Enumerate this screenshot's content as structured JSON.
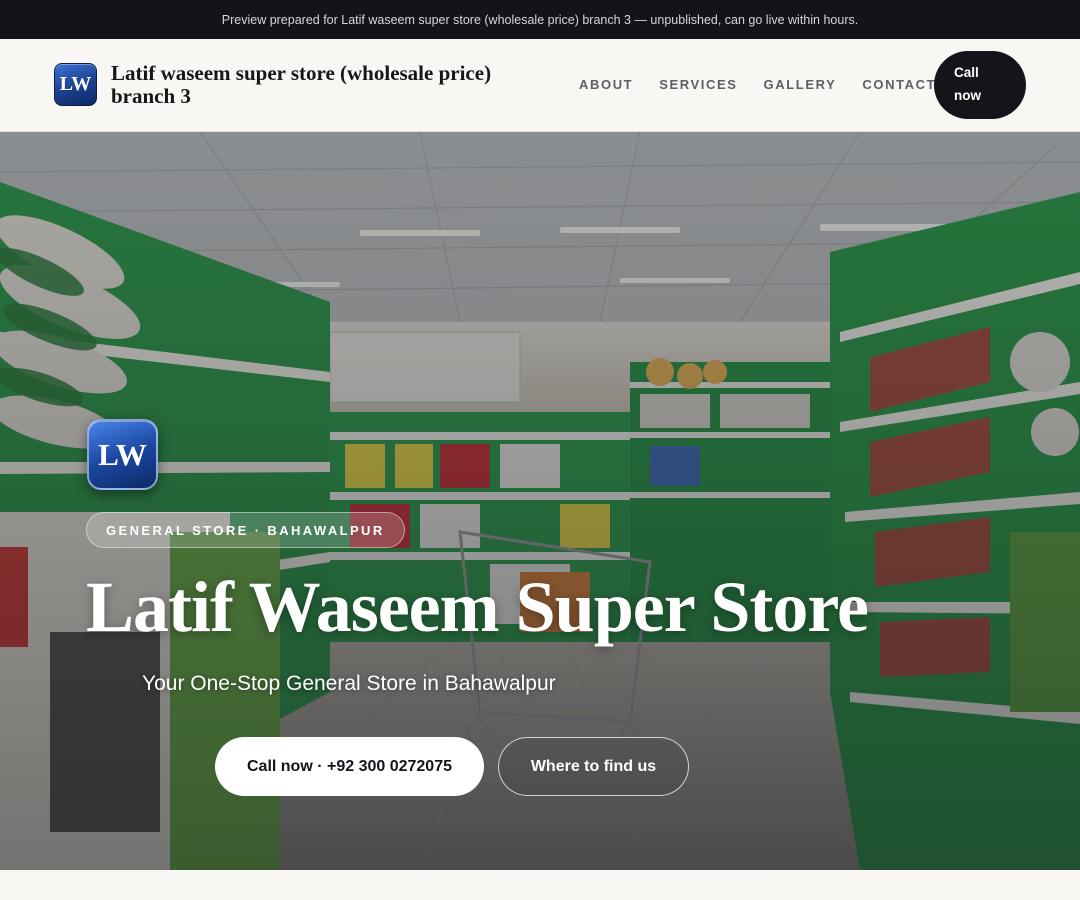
{
  "preview_bar": {
    "text": "Preview prepared for Latif waseem super store (wholesale price) branch 3 — unpublished, can go live within hours."
  },
  "header": {
    "logo_text": "LW",
    "brand_name": "Latif waseem super store (wholesale price) branch 3",
    "nav": [
      {
        "label": "ABOUT"
      },
      {
        "label": "SERVICES"
      },
      {
        "label": "GALLERY"
      },
      {
        "label": "CONTACT"
      }
    ],
    "call_button_line1": "Call",
    "call_button_line2": "now"
  },
  "hero": {
    "logo_text": "LW",
    "tagline": "GENERAL STORE · BAHAWALPUR",
    "title": "Latif Waseem Super Store",
    "subtitle": "Your One-Stop General Store in Bahawalpur",
    "primary_button": "Call now · +92 300 0272075",
    "secondary_button": "Where to find us"
  },
  "colors": {
    "dark": "#14151a",
    "background": "#f8f7f4",
    "logo_blue": "#1c48a3",
    "shelf_green": "#2f9e4f"
  }
}
